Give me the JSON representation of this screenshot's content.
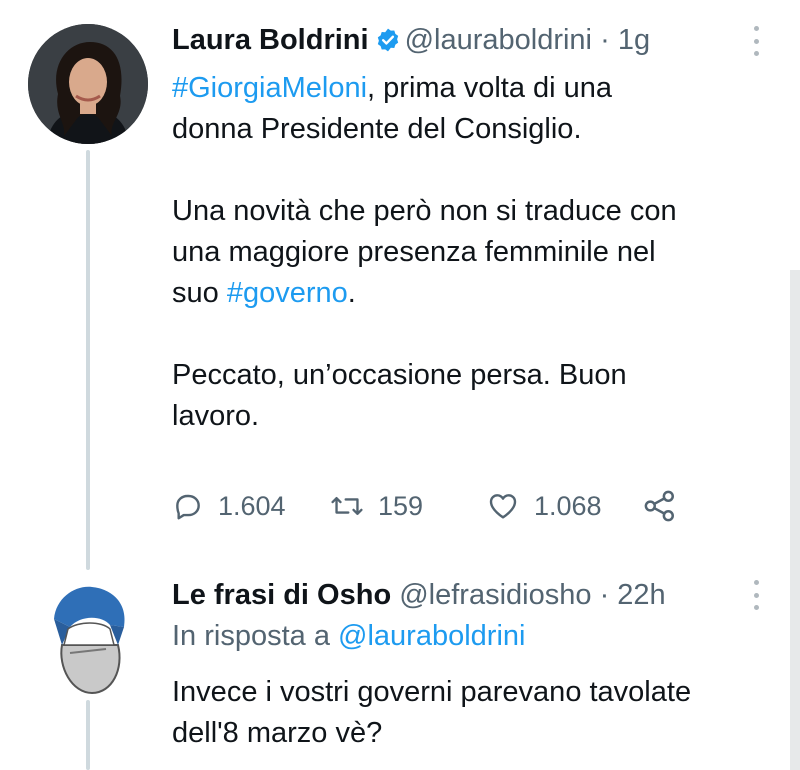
{
  "tweet1": {
    "name": "Laura Boldrini",
    "handle": "@lauraboldrini",
    "separator": "·",
    "time": "1g",
    "line1_hashtag": "#GiorgiaMeloni",
    "line1_rest": ", prima volta di una",
    "line2": "donna Presidente del Consiglio.",
    "line3": "Una novità che però non si traduce con",
    "line4": "una maggiore presenza femminile nel",
    "line5_pre": "suo ",
    "line5_hashtag": "#governo",
    "line5_post": ".",
    "line6": "Peccato, un’occasione persa. Buon",
    "line7": "lavoro.",
    "replies": "1.604",
    "retweets": "159",
    "likes": "1.068"
  },
  "tweet2": {
    "name": "Le frasi di Osho",
    "handle": "@lefrasidiosho",
    "separator": "·",
    "time": "22h",
    "reply_prefix": "In risposta a ",
    "reply_mention": "@lauraboldrini",
    "line1": "Invece i vostri governi parevano tavolate",
    "line2": "dell'8 marzo vè?"
  },
  "colors": {
    "accent": "#1d9bf0",
    "text": "#0f1419",
    "muted": "#536471",
    "thread_line": "#cfd9de"
  },
  "icons": [
    "verified-badge-icon",
    "reply-icon",
    "retweet-icon",
    "like-icon",
    "share-icon",
    "more-icon"
  ]
}
